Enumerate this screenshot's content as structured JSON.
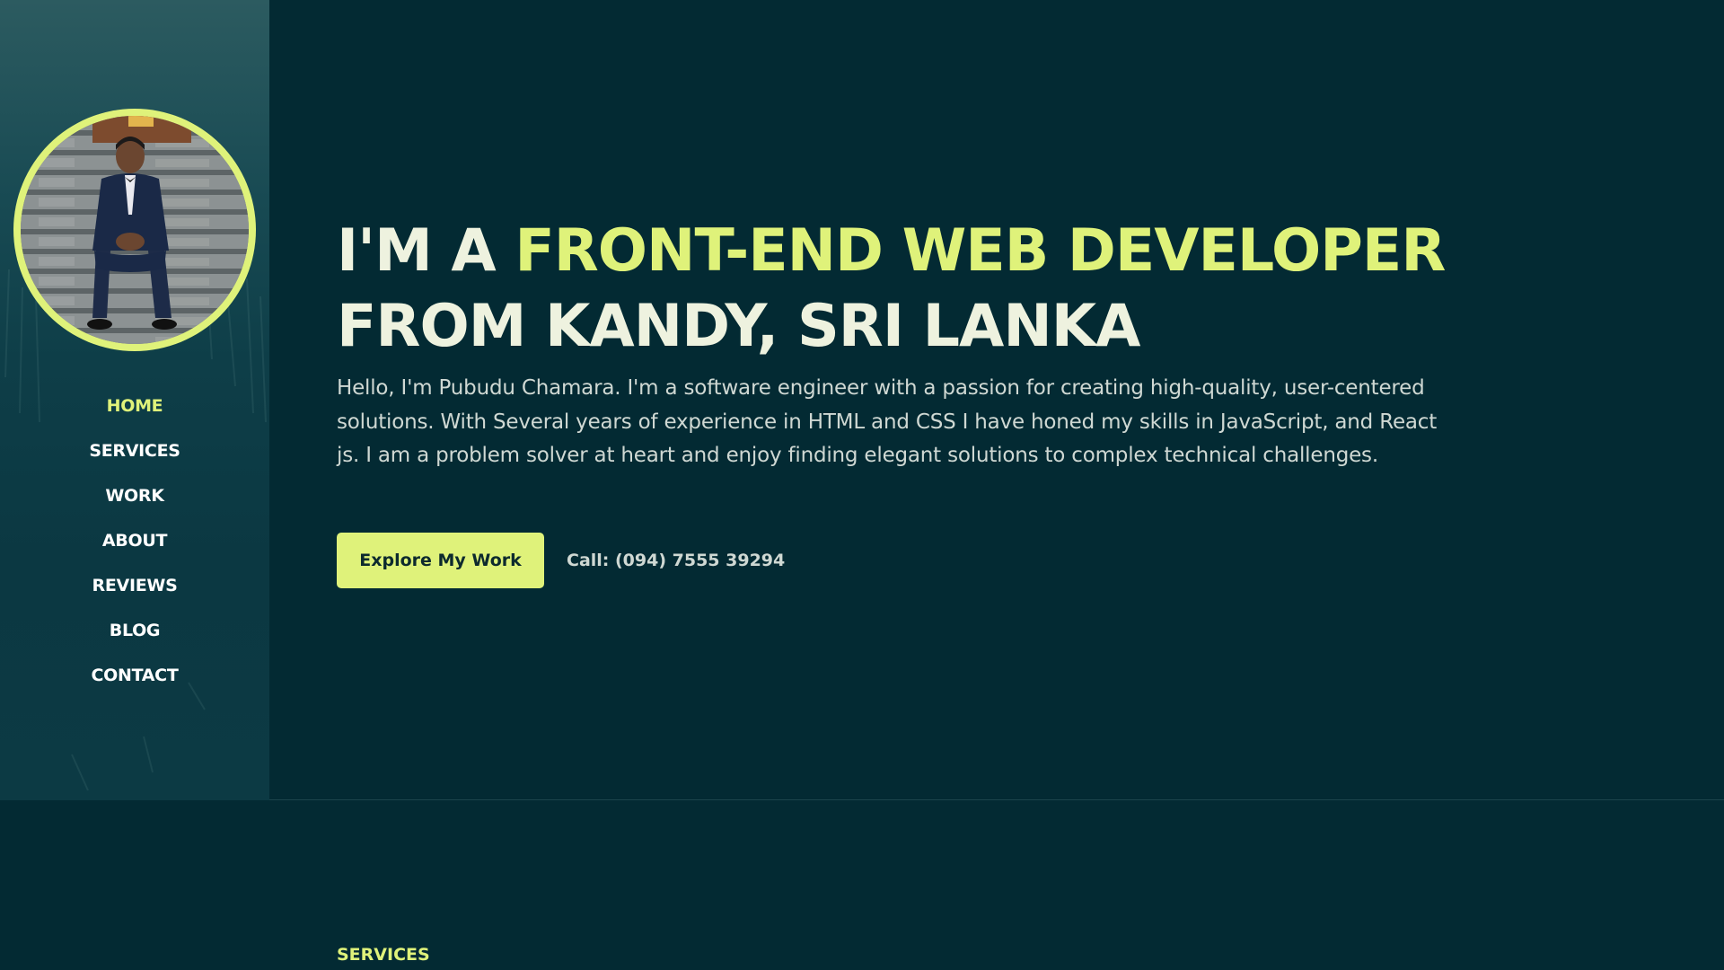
{
  "sidebar": {
    "avatar_alt": "Pubudu Chamara",
    "nav": [
      {
        "label": "HOME",
        "active": true
      },
      {
        "label": "SERVICES",
        "active": false
      },
      {
        "label": "WORK",
        "active": false
      },
      {
        "label": "ABOUT",
        "active": false
      },
      {
        "label": "REVIEWS",
        "active": false
      },
      {
        "label": "BLOG",
        "active": false
      },
      {
        "label": "CONTACT",
        "active": false
      }
    ]
  },
  "hero": {
    "headline_prefix": "I'M A ",
    "headline_accent": "FRONT-END WEB DEVELOPER",
    "headline_suffix": "FROM KANDY, SRI LANKA",
    "intro": "Hello, I'm Pubudu Chamara. I'm a software engineer with a passion for creating high-quality, user-centered solutions. With Several years of experience in HTML and CSS I have honed my skills in JavaScript, and React js. I am a problem solver at heart and enjoy finding elegant solutions to complex technical challenges.",
    "cta_label": "Explore My Work",
    "call_text": "Call: (094) 7555 39294"
  },
  "services": {
    "section_label": "SERVICES"
  },
  "colors": {
    "accent": "#dff27a",
    "background": "#032a33",
    "sidebar": "#0e3e48",
    "text": "#eef2df"
  },
  "icons": {
    "avatar": "profile-photo"
  }
}
